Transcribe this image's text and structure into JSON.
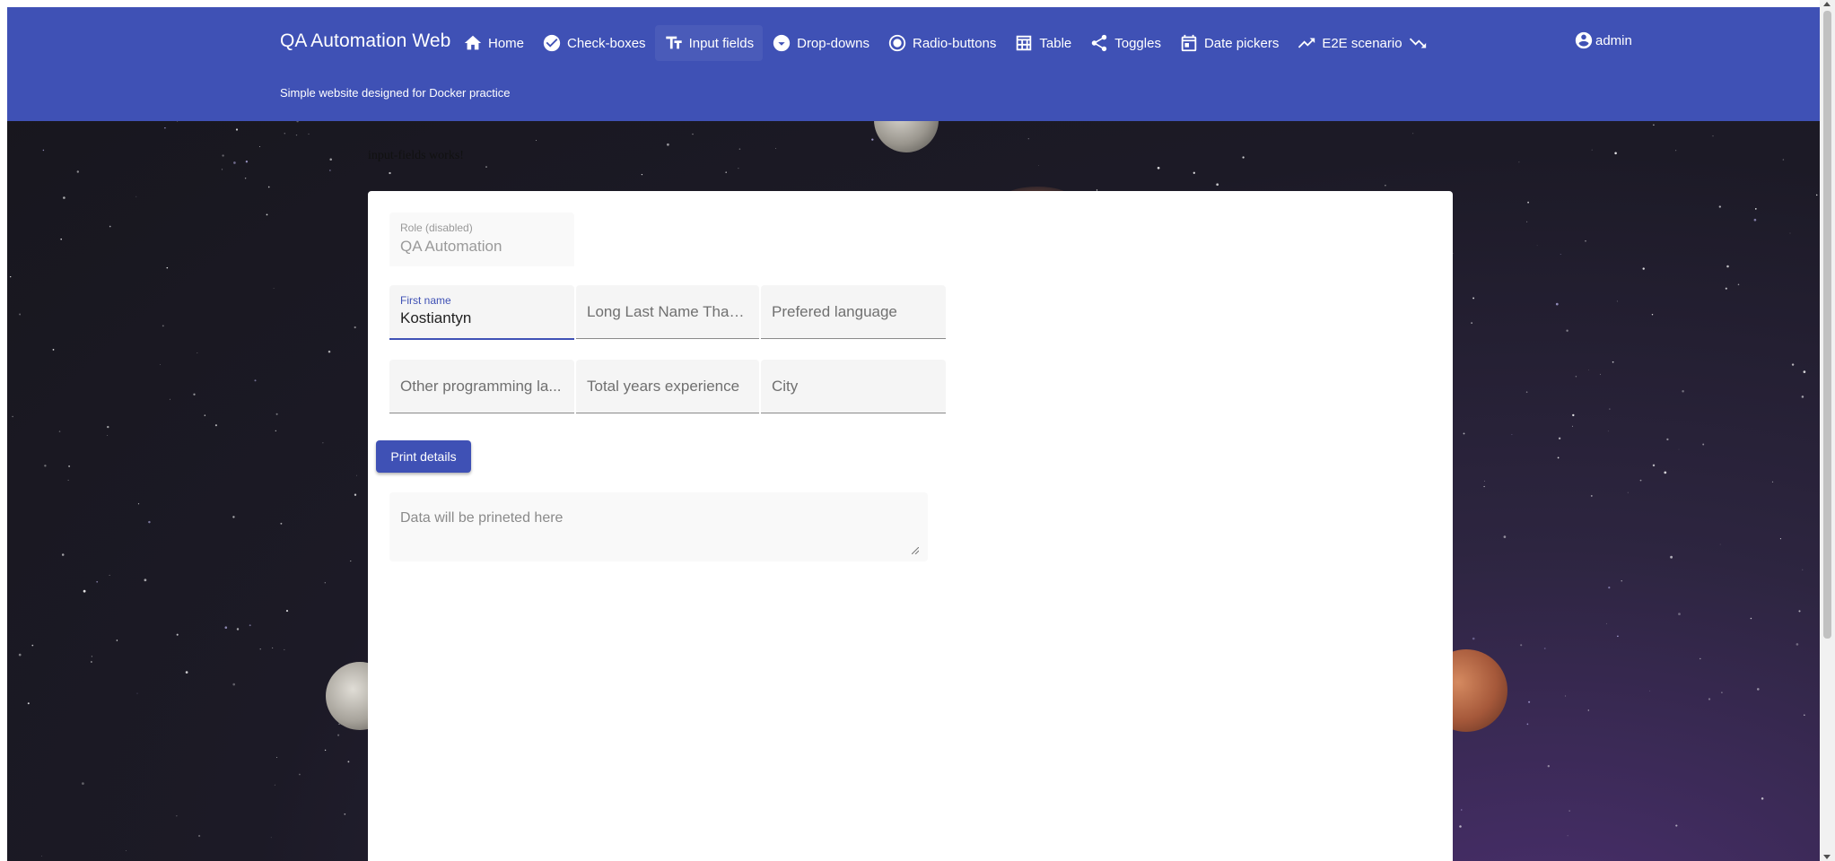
{
  "app": {
    "title": "QA Automation Web",
    "tagline": "Simple website designed for Docker practice",
    "user": "admin"
  },
  "nav": {
    "home": "Home",
    "checkboxes": "Check-boxes",
    "input_fields": "Input fields",
    "dropdowns": "Drop-downs",
    "radio_buttons": "Radio-buttons",
    "table": "Table",
    "toggles": "Toggles",
    "date_pickers": "Date pickers",
    "e2e": "E2E scenario",
    "active": "Input fields"
  },
  "status_text": "input-fields works!",
  "form": {
    "role": {
      "label": "Role (disabled)",
      "value": "QA Automation"
    },
    "first_name": {
      "label": "First name",
      "value": "Kostiantyn"
    },
    "last_name": {
      "placeholder": "Long Last Name That ..."
    },
    "language": {
      "placeholder": "Prefered language"
    },
    "other_languages": {
      "placeholder": "Other programming la..."
    },
    "experience": {
      "placeholder": "Total years experience"
    },
    "city": {
      "placeholder": "City"
    },
    "print_button": "Print details",
    "output": {
      "placeholder": "Data will be prineted here"
    }
  },
  "colors": {
    "primary": "#3f51b5",
    "background": "#1c1a26"
  },
  "icons": [
    "home-icon",
    "check-circle-icon",
    "text-fields-icon",
    "dropdown-circle-icon",
    "radio-button-icon",
    "table-icon",
    "share-icon",
    "calendar-icon",
    "trending-up-icon",
    "trending-down-icon",
    "account-circle-icon"
  ]
}
